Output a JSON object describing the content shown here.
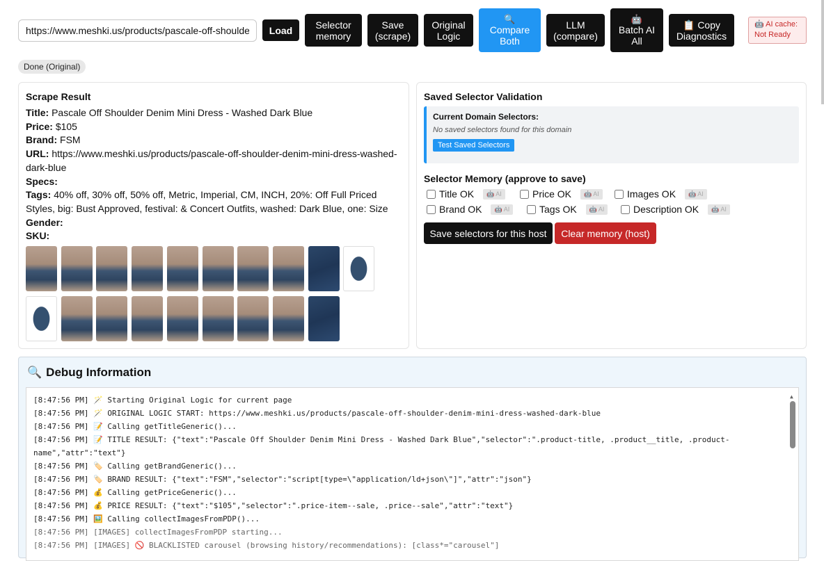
{
  "toolbar": {
    "url_value": "https://www.meshki.us/products/pascale-off-shoulder-d",
    "load": "Load",
    "selector_memory": [
      "Selector",
      "memory"
    ],
    "save_scrape": [
      "Save",
      "(scrape)"
    ],
    "original_logic": [
      "Original",
      "Logic"
    ],
    "compare_both": [
      "Compare",
      "Both"
    ],
    "llm_compare": [
      "LLM",
      "(compare)"
    ],
    "batch_ai": [
      "Batch AI",
      "All"
    ],
    "copy_diagnostics": [
      "Copy",
      "Diagnostics"
    ],
    "ai_cache": [
      "AI cache:",
      "Not Ready"
    ],
    "status": "Done (Original)",
    "colors": {
      "dark": "#111111",
      "primary": "#2196f3",
      "danger": "#c62828"
    }
  },
  "scrape": {
    "heading": "Scrape Result",
    "title_label": "Title:",
    "title": "Pascale Off Shoulder Denim Mini Dress - Washed Dark Blue",
    "price_label": "Price:",
    "price": "$105",
    "brand_label": "Brand:",
    "brand": "FSM",
    "url_label": "URL:",
    "url": "https://www.meshki.us/products/pascale-off-shoulder-denim-mini-dress-washed-dark-blue",
    "specs_label": "Specs:",
    "tags_label": "Tags:",
    "tags": "40% off, 30% off, 50% off, Metric, Imperial, CM, INCH, 20%: Off Full Priced Styles, big: Bust Approved, festival: & Concert Outfits, washed: Dark Blue, one: Size",
    "gender_label": "Gender:",
    "sku_label": "SKU:",
    "thumbnails": [
      "model-photo",
      "model-photo",
      "model-photo",
      "model-photo",
      "model-photo",
      "model-photo",
      "model-photo",
      "model-photo",
      "denim-swatch",
      "flat-product",
      "flat-product",
      "model-photo",
      "model-photo",
      "model-photo",
      "model-photo",
      "model-photo",
      "model-photo",
      "model-photo",
      "denim-swatch"
    ]
  },
  "validation": {
    "heading": "Saved Selector Validation",
    "domain_label": "Current Domain Selectors:",
    "domain_note": "No saved selectors found for this domain",
    "test_button": "Test Saved Selectors",
    "memory_heading": "Selector Memory (approve to save)",
    "checks": [
      "Title OK",
      "Price OK",
      "Images OK",
      "Brand OK",
      "Tags OK",
      "Description OK"
    ],
    "ai_badge": "AI",
    "save_button": "Save selectors for this host",
    "clear_button": "Clear memory (host)"
  },
  "debug": {
    "heading": "Debug Information",
    "lines": [
      "[8:47:56 PM] 🪄 Starting Original Logic for current page",
      "[8:47:56 PM] 🪄 ORIGINAL LOGIC START: https://www.meshki.us/products/pascale-off-shoulder-denim-mini-dress-washed-dark-blue",
      "[8:47:56 PM] 📝 Calling getTitleGeneric()...",
      "[8:47:56 PM] 📝 TITLE RESULT: {\"text\":\"Pascale Off Shoulder Denim Mini Dress - Washed Dark Blue\",\"selector\":\".product-title, .product__title, .product-name\",\"attr\":\"text\"}",
      "[8:47:56 PM] 🏷️ Calling getBrandGeneric()...",
      "[8:47:56 PM] 🏷️ BRAND RESULT: {\"text\":\"FSM\",\"selector\":\"script[type=\\\"application/ld+json\\\"]\",\"attr\":\"json\"}",
      "[8:47:56 PM] 💰 Calling getPriceGeneric()...",
      "[8:47:56 PM] 💰 PRICE RESULT: {\"text\":\"$105\",\"selector\":\".price-item--sale, .price--sale\",\"attr\":\"text\"}",
      "[8:47:56 PM] 🖼️ Calling collectImagesFromPDP()...",
      "[8:47:56 PM] [IMAGES] collectImagesFromPDP starting...",
      "[8:47:56 PM] [IMAGES] 🚫 BLACKLISTED carousel (browsing history/recommendations): [class*=\"carousel\"]"
    ]
  }
}
